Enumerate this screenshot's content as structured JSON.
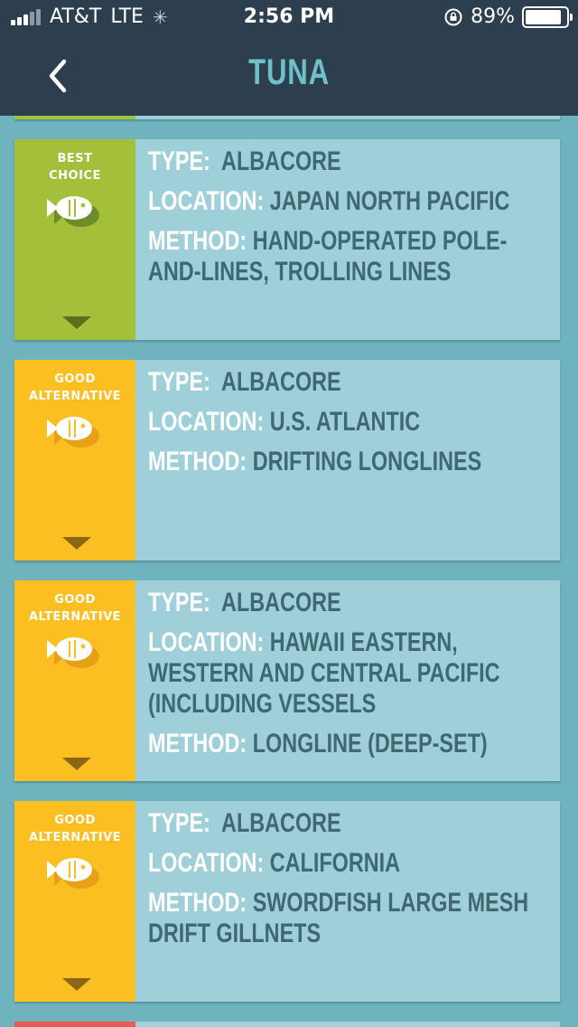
{
  "status_bar": {
    "carrier": "AT&T",
    "network": "LTE",
    "time": "2:56 PM",
    "battery": "89%",
    "battery_level": 0.89
  },
  "nav": {
    "title": "TUNA",
    "back_icon": "chevron-left-icon"
  },
  "colors": {
    "best_choice": "#a4bf3a",
    "good_alternative": "#fcbf22",
    "avoid": "#ea5b4f",
    "card_bg": "#9fd0da",
    "header_bg": "#2d3f4e"
  },
  "cards": [
    {
      "rating_line1": "BEST",
      "rating_line2": "CHOICE",
      "rating_class": "best",
      "type_label": "TYPE:",
      "type": "ALBACORE",
      "location_label": "LOCATION:",
      "location": "JAPAN NORTH PACIFIC",
      "method_label": "METHOD:",
      "method": "HAND-OPERATED POLE-AND-LINES, TROLLING LINES"
    },
    {
      "rating_line1": "GOOD",
      "rating_line2": "ALTERNATIVE",
      "rating_class": "good",
      "type_label": "TYPE:",
      "type": "ALBACORE",
      "location_label": "LOCATION:",
      "location": "U.S. ATLANTIC",
      "method_label": "METHOD:",
      "method": "DRIFTING LONGLINES"
    },
    {
      "rating_line1": "GOOD",
      "rating_line2": "ALTERNATIVE",
      "rating_class": "good",
      "type_label": "TYPE:",
      "type": "ALBACORE",
      "location_label": "LOCATION:",
      "location": "HAWAII EASTERN, WESTERN AND CENTRAL PACIFIC (INCLUDING VESSELS",
      "method_label": "METHOD:",
      "method": "LONGLINE (DEEP-SET)"
    },
    {
      "rating_line1": "GOOD",
      "rating_line2": "ALTERNATIVE",
      "rating_class": "good",
      "type_label": "TYPE:",
      "type": "ALBACORE",
      "location_label": "LOCATION:",
      "location": "CALIFORNIA",
      "method_label": "METHOD:",
      "method": "SWORDFISH LARGE MESH DRIFT GILLNETS"
    }
  ]
}
